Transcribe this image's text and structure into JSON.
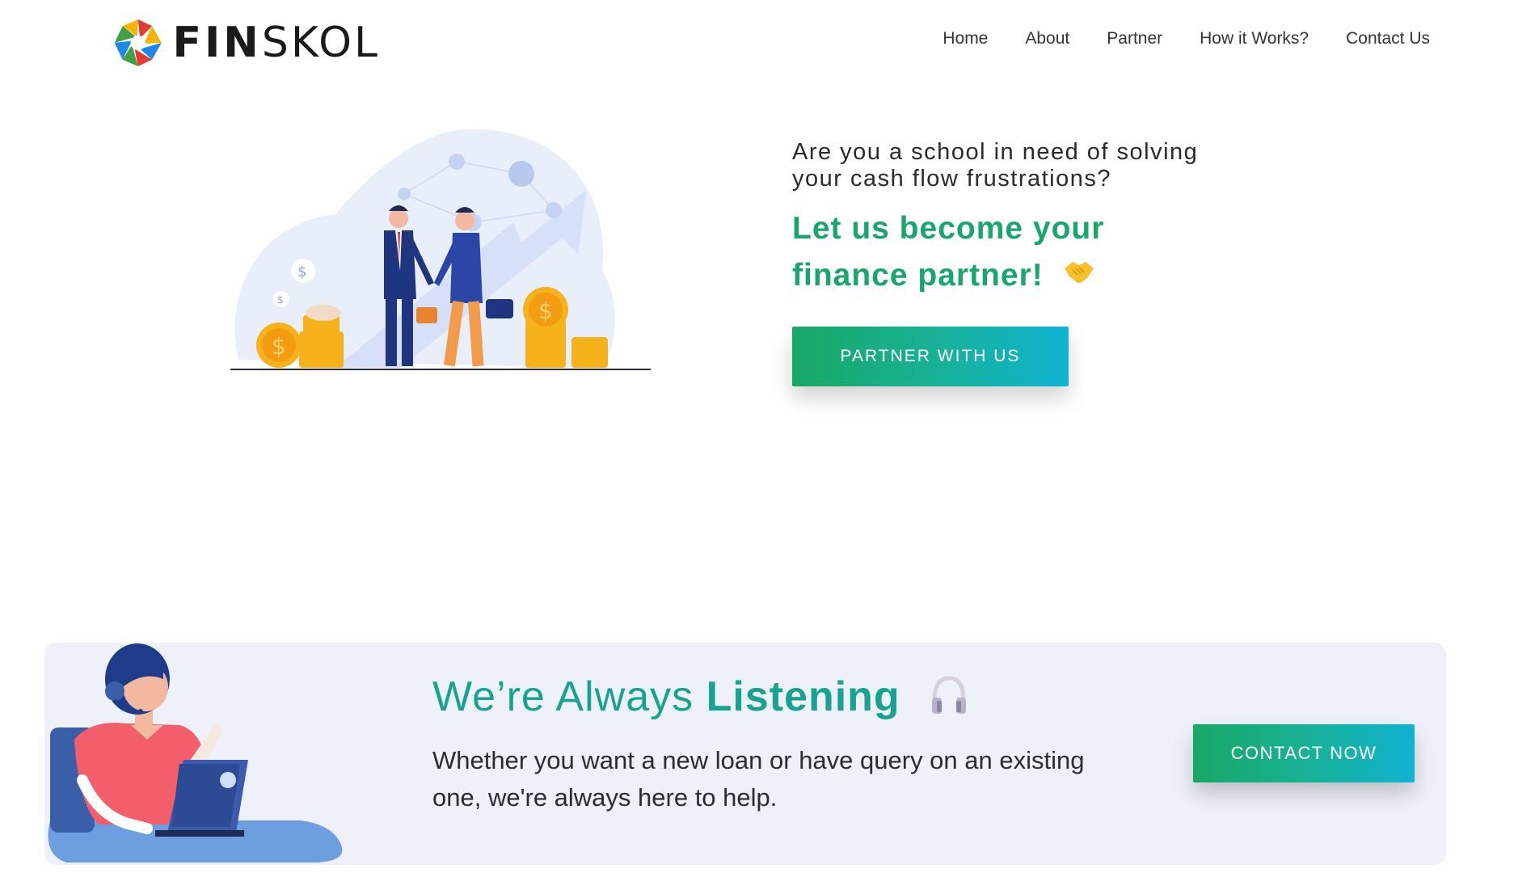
{
  "brand": {
    "name_bold": "FIN",
    "name_light": "SKOL"
  },
  "nav": {
    "items": [
      {
        "label": "Home"
      },
      {
        "label": "About"
      },
      {
        "label": "Partner"
      },
      {
        "label": "How it Works?"
      },
      {
        "label": "Contact Us"
      }
    ]
  },
  "hero": {
    "question": "Are you a school in need of solving your cash flow frustrations?",
    "headline_line1": "Let us become your",
    "headline_line2": "finance partner!",
    "cta_label": "PARTNER WITH US"
  },
  "listening": {
    "title_light": "We’re Always",
    "title_bold": "Listening",
    "body": "Whether you want a new loan or have query on an existing one, we're always here to help.",
    "cta_label": "CONTACT NOW"
  },
  "icons": {
    "logo": "aperture-logo-icon",
    "handshake": "handshake-icon",
    "headphones": "headphones-icon"
  },
  "colors": {
    "brand_green": "#1aa56b",
    "teal": "#17a38f",
    "button_gradient_start": "#18a866",
    "button_gradient_end": "#10b3d2",
    "band_background": "#eef0fa"
  }
}
